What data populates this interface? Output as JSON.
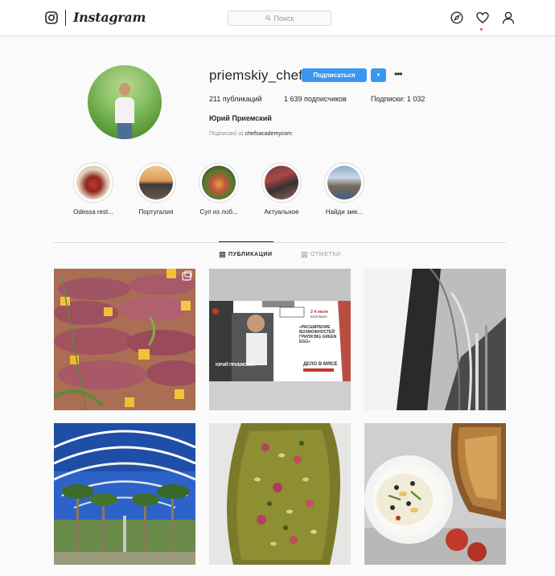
{
  "header": {
    "logo_text": "Instagram",
    "search_placeholder": "Поиск"
  },
  "profile": {
    "username": "priemskiy_chef",
    "follow_label": "Подписаться",
    "posts": "211 публикаций",
    "followers": "1 639 подписчиков",
    "following": "Подписки: 1 032",
    "full_name": "Юрий Приемский",
    "followed_by_prefix": "Подписан(-а)",
    "followed_by_account": "chefsacademycom"
  },
  "highlights": [
    {
      "label": "Odessa rest..."
    },
    {
      "label": "Португалия"
    },
    {
      "label": "Суп из лоб..."
    },
    {
      "label": "Актуальное"
    },
    {
      "label": "Найди зме..."
    }
  ],
  "tabs": [
    {
      "label": "ПУБЛИКАЦИИ",
      "active": true
    },
    {
      "label": "ОТМЕТКИ",
      "active": false
    }
  ],
  "posts": [
    {
      "name": "post-duck-carpaccio",
      "multi": true
    },
    {
      "name": "post-event-poster",
      "poster": {
        "chef_name": "ЮРИЙ ПРИЕМСКИЙ",
        "headline": "«РАСШИРЕНИЕ ВОЗМОЖНОСТЕЙ ГРИЛЯ BIG GREEN EGG»",
        "topic": "ДЕЛО В МЯСЕ",
        "date": "2-4 июля",
        "tag": "ВПЕРВЫЕ!"
      }
    },
    {
      "name": "post-staircase"
    },
    {
      "name": "post-palm-arcade"
    },
    {
      "name": "post-tart"
    },
    {
      "name": "post-dip-toast"
    }
  ],
  "colors": {
    "accent": "#3897f0",
    "text": "#262626",
    "muted": "#8e8e8e",
    "border": "#dbdbdb",
    "notification": "#ed4956"
  }
}
